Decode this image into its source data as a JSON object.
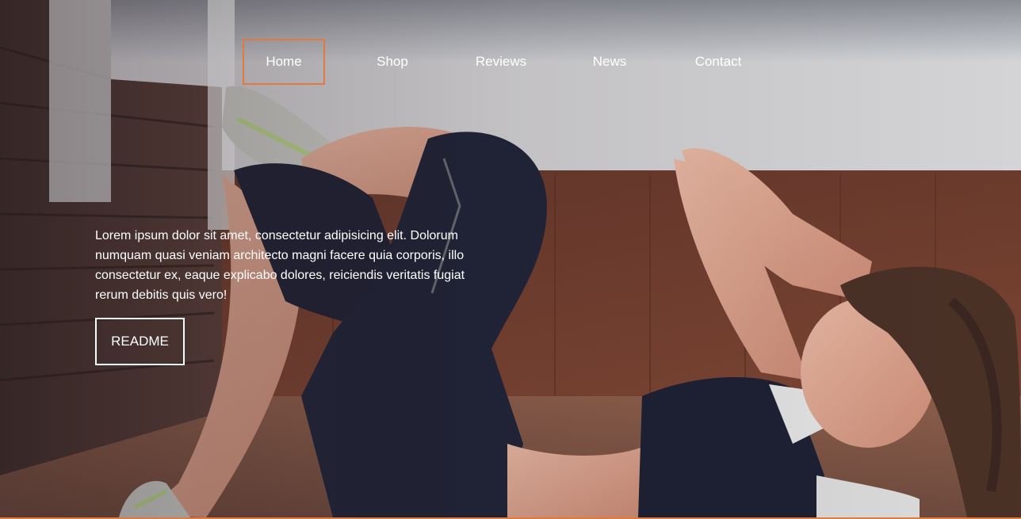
{
  "nav": {
    "items": [
      {
        "label": "Home",
        "active": true
      },
      {
        "label": "Shop",
        "active": false
      },
      {
        "label": "Reviews",
        "active": false
      },
      {
        "label": "News",
        "active": false
      },
      {
        "label": "Contact",
        "active": false
      }
    ]
  },
  "hero": {
    "text": "Lorem ipsum dolor sit amet, consectetur adipisicing elit. Dolorum numquam quasi veniam architecto magni facere quia corporis, illo consectetur ex, eaque explicabo dolores, reiciendis veritatis fugiat rerum debitis quis vero!",
    "button_label": "README"
  },
  "colors": {
    "accent": "#e07a3f",
    "text": "#ffffff"
  }
}
